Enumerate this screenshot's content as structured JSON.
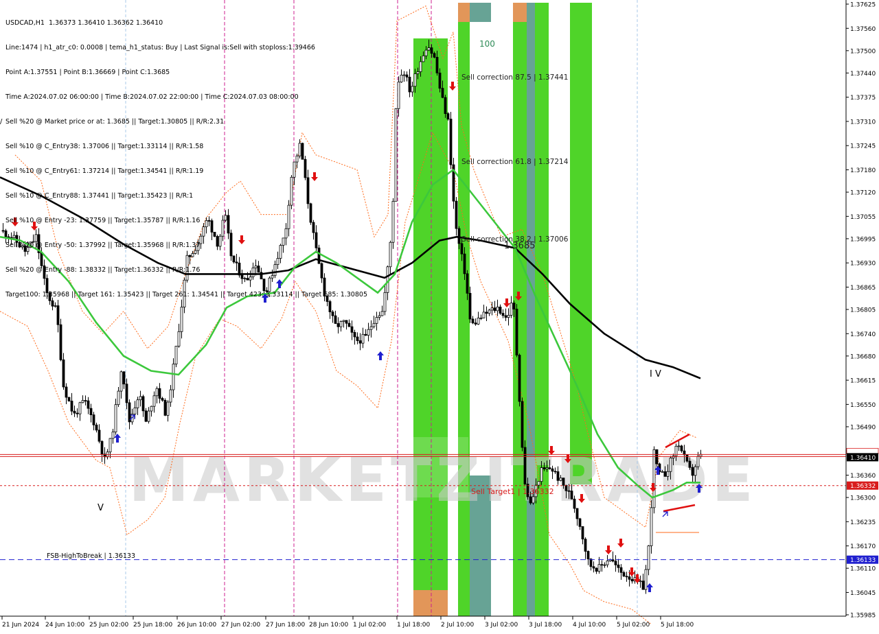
{
  "header": {
    "lines": [
      "USDCAD,H1  1.36373 1.36410 1.36362 1.36410",
      "Line:1474 | h1_atr_c0: 0.0008 | tema_h1_status: Buy | Last Signal is:Sell with stoploss:1.39466",
      "Point A:1.37551 | Point B:1.36669 | Point C:1.3685",
      "Time A:2024.07.02 06:00:00 | Time B:2024.07.02 22:00:00 | Time C:2024.07.03 08:00:00",
      "Sell %20 @ Market price or at: 1.3685 || Target:1.30805 || R/R:2.31",
      "Sell %10 @ C_Entry38: 1.37006 || Target:1.33114 || R/R:1.58",
      "Sell %10 @ C_Entry61: 1.37214 || Target:1.34541 || R/R:1.19",
      "Sell %10 @ C_Entry88: 1.37441 || Target:1.35423 || R/R:1",
      "Sell %10 @ Entry -23: 1.37759 || Target:1.35787 || R/R:1.16",
      "Sell %20 @ Entry -50: 1.37992 || Target:1.35968 || R/R:1.37",
      "Sell %20 @ Entry -88: 1.38332 || Target:1.36332 || R/R:1.76",
      "Target100: 1.35968 || Target 161: 1.35423 || Target 261: 1.34541 || Target 423: 1.33114 || Target 685: 1.30805"
    ]
  },
  "colors": {
    "background": "#ffffff",
    "bull_candle": "#000000",
    "bear_candle": "#000000",
    "ma_black": "#000000",
    "ma_green": "#3cc83c",
    "envelope": "#ff6a1a",
    "vline": "#cc1f8f",
    "vline_light": "#a8c8e8",
    "fsb_line": "#1f1fcf",
    "price_red": "#d81c1c",
    "price_blue": "#1f1fcf",
    "green_zone": "#46d21e",
    "teal_zone": "#5f9e8f",
    "orange_zone": "#e09050",
    "buy_arrow": "#1f1fcf",
    "sell_arrow": "#e01010",
    "watermark": "#d8d8d8"
  },
  "chart_data": {
    "type": "candlestick",
    "symbol": "USDCAD",
    "timeframe": "H1",
    "watermark": "MARKETZITRADE",
    "ylim": [
      1.35985,
      1.37625
    ],
    "y_ticks": [
      1.37625,
      1.3756,
      1.375,
      1.3744,
      1.37375,
      1.3731,
      1.37245,
      1.3718,
      1.3712,
      1.37055,
      1.36995,
      1.3693,
      1.36865,
      1.36805,
      1.3674,
      1.3668,
      1.36615,
      1.3655,
      1.3649,
      1.36425,
      1.3636,
      1.363,
      1.36235,
      1.3617,
      1.3611,
      1.36045,
      1.35985
    ],
    "y_tick_labels": [
      "1.37625",
      "1.37560",
      "1.37500",
      "1.37440",
      "1.37375",
      "1.37310",
      "1.37245",
      "1.37180",
      "1.37120",
      "1.37055",
      "1.36995",
      "1.36930",
      "1.36865",
      "1.36805",
      "1.36740",
      "1.36680",
      "1.36615",
      "1.36550",
      "1.36490",
      "1.36425",
      "1.36360",
      "1.36300",
      "1.36235",
      "1.36170",
      "1.36110",
      "1.36045",
      "1.35985"
    ],
    "x_labels": [
      "21 Jun 2024",
      "24 Jun 10:00",
      "25 Jun 02:00",
      "25 Jun 18:00",
      "26 Jun 10:00",
      "27 Jun 02:00",
      "27 Jun 18:00",
      "28 Jun 10:00",
      "1 Jul 02:00",
      "1 Jul 18:00",
      "2 Jul 10:00",
      "3 Jul 02:00",
      "3 Jul 18:00",
      "4 Jul 10:00",
      "5 Jul 02:00",
      "5 Jul 18:00"
    ],
    "bar_count": 240,
    "price_lines": [
      {
        "name": "current-price",
        "value": 1.3641,
        "label": "1.36410",
        "color": "#d81c1c"
      },
      {
        "name": "sell-target",
        "value": 1.36332,
        "label": "1.36332",
        "color": "#d81c1c"
      },
      {
        "name": "fsb-high-to-break",
        "value": 1.36133,
        "label": "1.36133",
        "color": "#1f1fcf"
      }
    ],
    "annotations": [
      {
        "name": "label-100",
        "text": "100",
        "color": "#2e8b57"
      },
      {
        "name": "sell-correction-875",
        "text": "Sell correction 87.5 | 1.37441"
      },
      {
        "name": "sell-correction-618",
        "text": "Sell correction 61.8 | 1.37214"
      },
      {
        "name": "sell-correction-382",
        "text": "Sell correction 38.2 | 1.37006"
      },
      {
        "name": "label-13685",
        "text": "1.3685"
      },
      {
        "name": "sell-target-1",
        "text": "Sell Target1 | 1.36332",
        "color": "#d81c1c"
      },
      {
        "name": "fsb-label",
        "text": "FSB-HighToBreak | 1.36133"
      },
      {
        "name": "wave-label-v",
        "text": "V"
      },
      {
        "name": "wave-label-iv",
        "text": "I V"
      }
    ]
  }
}
